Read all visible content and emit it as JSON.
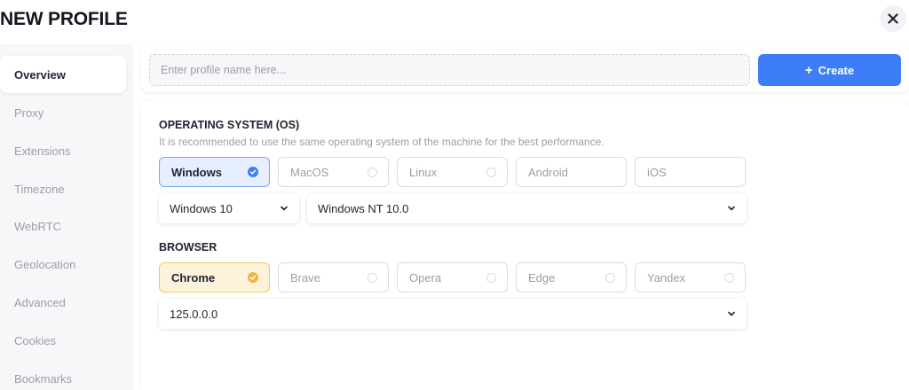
{
  "header": {
    "title": "NEW PROFILE",
    "close_icon": "close-icon"
  },
  "sidebar": {
    "items": [
      {
        "label": "Overview",
        "active": true
      },
      {
        "label": "Proxy",
        "active": false
      },
      {
        "label": "Extensions",
        "active": false
      },
      {
        "label": "Timezone",
        "active": false
      },
      {
        "label": "WebRTC",
        "active": false
      },
      {
        "label": "Geolocation",
        "active": false
      },
      {
        "label": "Advanced",
        "active": false
      },
      {
        "label": "Cookies",
        "active": false
      },
      {
        "label": "Bookmarks",
        "active": false
      }
    ]
  },
  "profile": {
    "name_placeholder": "Enter profile name here...",
    "name_value": "",
    "create_label": "Create",
    "create_icon": "plus-icon"
  },
  "os": {
    "title": "OPERATING SYSTEM (OS)",
    "description": "It is recommended to use the same operating system of the machine for the best performance.",
    "options": [
      "Windows",
      "MacOS",
      "Linux",
      "Android",
      "iOS"
    ],
    "selected": "Windows",
    "version_select": "Windows 10",
    "nt_select": "Windows NT 10.0"
  },
  "browser": {
    "title": "BROWSER",
    "options": [
      "Chrome",
      "Brave",
      "Opera",
      "Edge",
      "Yandex"
    ],
    "selected": "Chrome",
    "version_select": "125.0.0.0"
  },
  "colors": {
    "accent_blue": "#3d7ef6",
    "selected_blue_bg": "#e6effd",
    "selected_orange_bg": "#fdf3db",
    "check_orange": "#f1b53e"
  }
}
